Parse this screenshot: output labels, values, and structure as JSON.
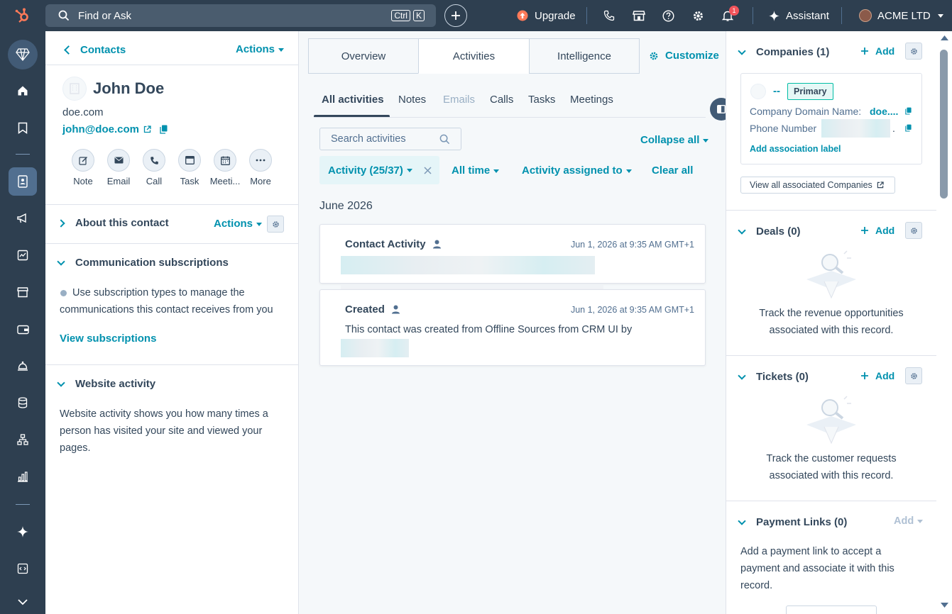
{
  "topbar": {
    "search_placeholder": "Find or Ask",
    "kbd_ctrl": "Ctrl",
    "kbd_k": "K",
    "upgrade_label": "Upgrade",
    "notification_count": "1",
    "assistant_label": "Assistant",
    "account_name": "ACME LTD"
  },
  "contact": {
    "back_label": "Contacts",
    "actions_label": "Actions",
    "name": "John Doe",
    "domain": "doe.com",
    "email": "john@doe.com",
    "quick_actions": [
      {
        "label": "Note"
      },
      {
        "label": "Email"
      },
      {
        "label": "Call"
      },
      {
        "label": "Task"
      },
      {
        "label": "Meeti..."
      },
      {
        "label": "More"
      }
    ],
    "about_title": "About this contact",
    "about_actions_label": "Actions",
    "comm_title": "Communication subscriptions",
    "comm_text_1": "Use subscription types to manage the",
    "comm_text_2": "communications this contact receives from you",
    "view_subscriptions": "View subscriptions",
    "website_title": "Website activity",
    "website_text_1": "Website activity shows you how many times a",
    "website_text_2": "person has visited your site and viewed your",
    "website_text_3": "pages."
  },
  "middle": {
    "tabs": [
      "Overview",
      "Activities",
      "Intelligence"
    ],
    "customize_label": "Customize",
    "subtabs": [
      "All activities",
      "Notes",
      "Emails",
      "Calls",
      "Tasks",
      "Meetings"
    ],
    "search_placeholder": "Search activities",
    "collapse_all": "Collapse all",
    "filter_activity": "Activity (25/37)",
    "filter_time": "All time",
    "filter_assigned": "Activity assigned to",
    "clear_all": "Clear all",
    "month_heading": "June 2026",
    "activities": [
      {
        "title": "Contact Activity",
        "timestamp": "Jun 1, 2026 at 9:35 AM GMT+1",
        "body": ""
      },
      {
        "title": "Created",
        "timestamp": "Jun 1, 2026 at 9:35 AM GMT+1",
        "body": "This contact was created from Offline Sources from CRM UI by"
      }
    ]
  },
  "right": {
    "companies_title": "Companies (1)",
    "add_label": "Add",
    "company_name": "--",
    "primary_badge": "Primary",
    "company_domain_label": "Company Domain Name:",
    "company_domain_value": "doe....",
    "phone_label": "Phone Number",
    "phone_suffix": ".",
    "add_association_label": "Add association label",
    "view_all_companies": "View all associated Companies",
    "deals_title": "Deals (0)",
    "deals_text_1": "Track the revenue opportunities",
    "deals_text_2": "associated with this record.",
    "tickets_title": "Tickets (0)",
    "tickets_text_1": "Track the customer requests",
    "tickets_text_2": "associated with this record.",
    "payment_title": "Payment Links (0)",
    "payment_add": "Add",
    "payment_text_1": "Add a payment link to accept a",
    "payment_text_2": "payment and associate it with this",
    "payment_text_3": "record."
  },
  "colors": {
    "topbar_bg": "#2e3f50",
    "accent_teal": "#0091ae",
    "upgrade_orange": "#ff7a59",
    "badge_red": "#f2545b"
  }
}
